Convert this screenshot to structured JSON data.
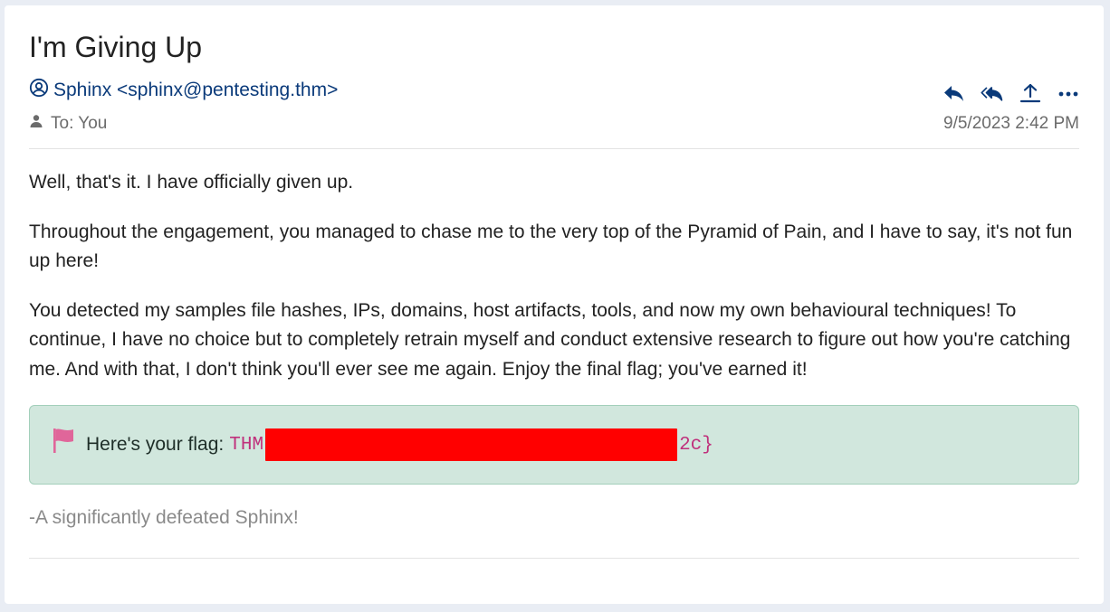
{
  "email": {
    "subject": "I'm Giving Up",
    "sender": "Sphinx <sphinx@pentesting.thm>",
    "to": "To: You",
    "timestamp": "9/5/2023 2:42 PM",
    "actions": [
      {
        "name": "reply",
        "icon": "reply-icon"
      },
      {
        "name": "reply-all",
        "icon": "reply-all-icon"
      },
      {
        "name": "forward",
        "icon": "share-upload-icon"
      },
      {
        "name": "more",
        "icon": "more-options-icon"
      }
    ],
    "paragraphs": [
      "Well, that's it. I have officially given up.",
      "Throughout the engagement, you managed to chase me to the very top of the Pyramid of Pain, and I have to say, it's not fun up here!",
      "You detected my samples file hashes, IPs, domains, host artifacts, tools, and now my own behavioural techniques! To continue, I have no choice but to completely retrain myself and conduct extensive research to figure out how you're catching me. And with that, I don't think you'll ever see me again. Enjoy the final flag; you've earned it!"
    ],
    "flag": {
      "label": "Here's your flag:",
      "prefix": "THM",
      "suffix": "2c}",
      "redacted": true
    },
    "signoff": "-A significantly defeated Sphinx!"
  },
  "colors": {
    "sender_link": "#0a3a7a",
    "flag_bg": "#d1e7dd",
    "flag_code": "#c0317c",
    "flag_icon": "#e0669a",
    "redaction": "#ff0000"
  }
}
